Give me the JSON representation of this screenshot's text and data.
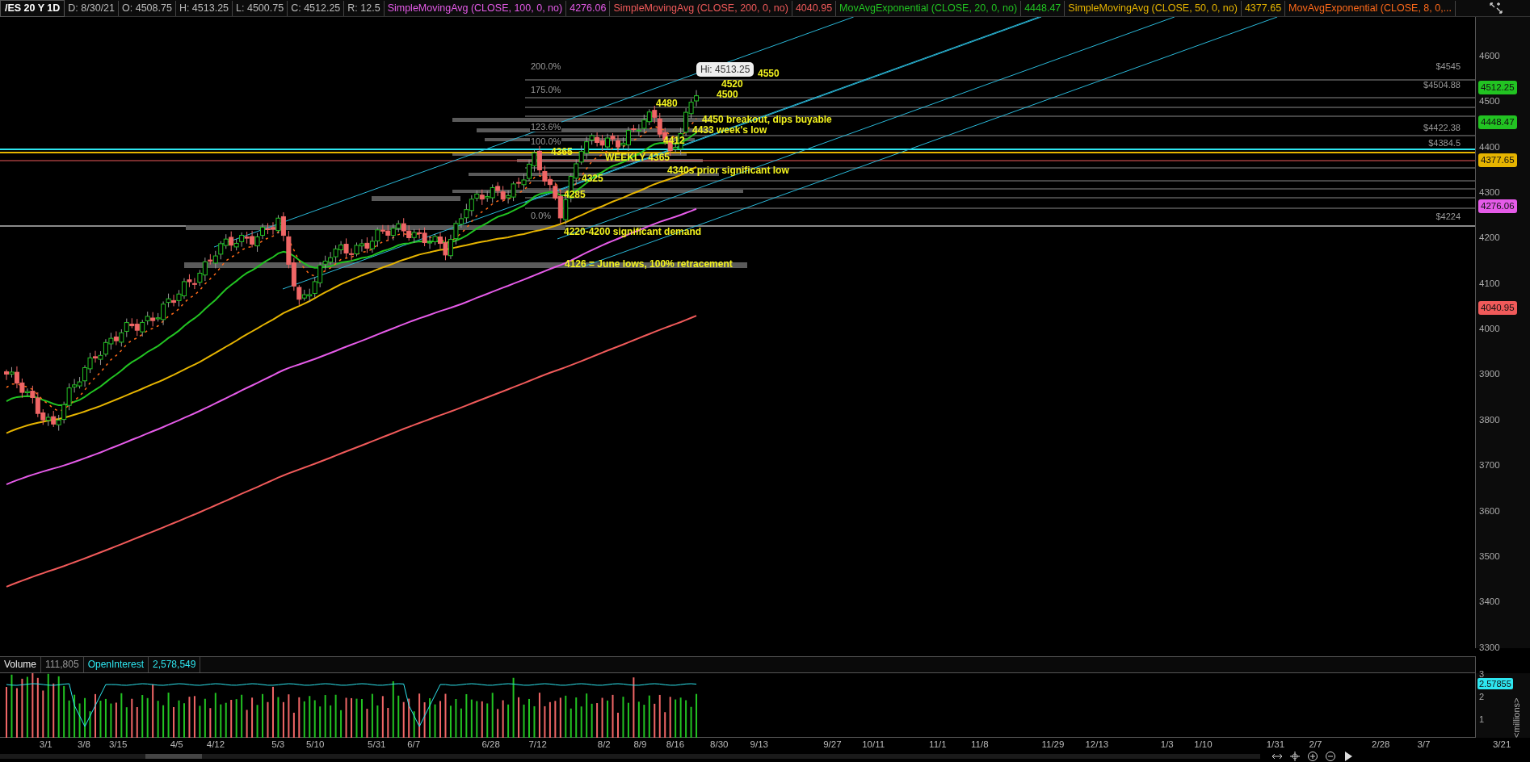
{
  "header": {
    "symbol": "/ES 20 Y 1D",
    "quote": [
      {
        "text": "D: 8/30/21"
      },
      {
        "text": "O: 4508.75"
      },
      {
        "text": "H: 4513.25"
      },
      {
        "text": "L: 4500.75"
      },
      {
        "text": "C: 4512.25"
      },
      {
        "text": "R: 12.5"
      }
    ],
    "studies": [
      {
        "name": "SimpleMovingAvg (CLOSE, 100, 0, no)",
        "value": "4276.06",
        "color": "#e55be8"
      },
      {
        "name": "SimpleMovingAvg (CLOSE, 200, 0, no)",
        "value": "4040.95",
        "color": "#f05a5a"
      },
      {
        "name": "MovAvgExponential (CLOSE, 20, 0, no)",
        "value": "4448.47",
        "color": "#22c322"
      },
      {
        "name": "SimpleMovingAvg (CLOSE, 50, 0, no)",
        "value": "4377.65",
        "color": "#e6b400"
      },
      {
        "name": "MovAvgExponential (CLOSE, 8, 0,...",
        "color": "#ff6a1a"
      }
    ]
  },
  "price_axis": [
    "4600",
    "4500",
    "4400",
    "4300",
    "4200",
    "4100",
    "4000",
    "3900",
    "3800",
    "3700",
    "3600",
    "3500",
    "3400",
    "3300"
  ],
  "price_tags": [
    {
      "text": "4512.25",
      "color": "#22c322"
    },
    {
      "text": "4448.47",
      "color": "#22c322"
    },
    {
      "text": "4377.65",
      "color": "#e6b400"
    },
    {
      "text": "4276.06",
      "color": "#e55be8"
    },
    {
      "text": "4040.95",
      "color": "#f05a5a"
    }
  ],
  "fib_levels": [
    {
      "percent": "200.0%",
      "price": "$4545"
    },
    {
      "percent": "175.0%",
      "price": "$4504.88"
    },
    {
      "percent": "123.6%",
      "price": "$4422.38"
    },
    {
      "percent": "100.0%",
      "price": "$4384.5"
    },
    {
      "percent": "0.0%",
      "price": "$4224"
    }
  ],
  "high_bubble": "Hi: 4513.25",
  "annotations": [
    "4550",
    "4520",
    "4500",
    "4480",
    "4450 breakout, dips buyable",
    "4433 week's low",
    "4412",
    "4365",
    "WEEKLY 4365",
    "4340s prior significant low",
    "4325",
    "4285",
    "4220-4200 significant demand",
    "4126 = June lows, 100% retracement"
  ],
  "volume": {
    "label": "Volume",
    "value": "111,805",
    "oi_label": "OpenInterest",
    "oi_value": "2,578,549",
    "axis": [
      "3",
      "2",
      "1"
    ],
    "oi_tag": "2.57855",
    "unit": "<millions>"
  },
  "dates": [
    "3/1",
    "3/8",
    "3/15",
    "4/5",
    "4/12",
    "5/3",
    "5/10",
    "5/31",
    "6/7",
    "6/28",
    "7/12",
    "8/2",
    "8/9",
    "8/16",
    "8/30",
    "9/13",
    "9/27",
    "10/11",
    "11/1",
    "11/8",
    "11/29",
    "12/13",
    "1/3",
    "1/10",
    "1/31",
    "2/7",
    "2/28",
    "3/7",
    "3/21"
  ]
}
